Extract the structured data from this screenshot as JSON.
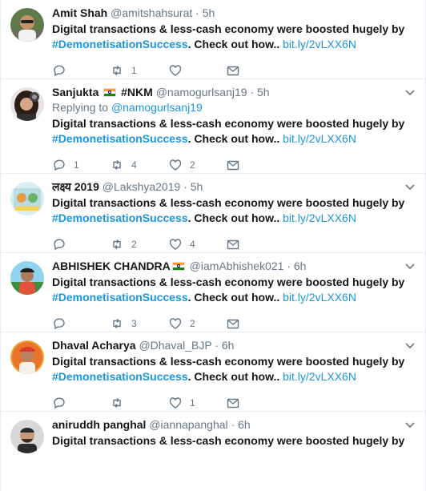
{
  "colors": {
    "accent": "#1b95e0",
    "muted": "#657786",
    "text": "#14171a",
    "border": "#e6ecf0"
  },
  "tweets": [
    {
      "name": "Amit Shah",
      "handle": "@amitshahsurat",
      "time": "5h",
      "avatar_icon": "amit-avatar",
      "text_plain": "Digital transactions & less-cash economy were boosted hugely by",
      "hashtag": "#DemonetisationSuccess",
      "text_tail": ". Check out how..",
      "link": "bit.ly/2vLXX6N",
      "replies": "",
      "retweets": "1",
      "likes": ""
    },
    {
      "name": "Sanjukta",
      "name_suffix": "#NKM",
      "handle": "@namogurlsanj19",
      "time": "5h",
      "replying_label": "Replying to",
      "replying_handle": "@namogurlsanj19",
      "avatar_icon": "sanjukta-avatar",
      "text_plain": "Digital transactions & less-cash economy were boosted hugely by",
      "hashtag": "#DemonetisationSuccess",
      "text_tail": ". Check out how..",
      "link": "bit.ly/2vLXX6N",
      "replies": "1",
      "retweets": "4",
      "likes": "2"
    },
    {
      "name": "लक्ष्य 2019",
      "handle": "@Lakshya2019",
      "time": "5h",
      "avatar_icon": "lakshya-avatar",
      "text_plain": "Digital transactions & less-cash economy were boosted hugely by",
      "hashtag": "#DemonetisationSuccess",
      "text_tail": ". Check out how..",
      "link": "bit.ly/2vLXX6N",
      "replies": "",
      "retweets": "2",
      "likes": "4"
    },
    {
      "name": "ABHISHEK CHANDRA",
      "handle": "@iamAbhishek021",
      "time": "6h",
      "avatar_icon": "abhishek-avatar",
      "text_plain": "Digital transactions & less-cash economy were boosted hugely by",
      "hashtag": "#DemonetisationSuccess",
      "text_tail": ". Check out how..",
      "link": "bit.ly/2vLXX6N",
      "replies": "",
      "retweets": "3",
      "likes": "2"
    },
    {
      "name": "Dhaval Acharya",
      "handle": "@Dhaval_BJP",
      "time": "6h",
      "avatar_icon": "dhaval-avatar",
      "text_plain": "Digital transactions & less-cash economy were boosted hugely by",
      "hashtag": "#DemonetisationSuccess",
      "text_tail": ". Check out how..",
      "link": "bit.ly/2vLXX6N",
      "replies": "",
      "retweets": "",
      "likes": "1"
    },
    {
      "name": "aniruddh panghal",
      "handle": "@iannapanghal",
      "time": "6h",
      "avatar_icon": "aniruddh-avatar",
      "text_plain": "Digital transactions & less-cash economy were boosted hugely by",
      "hashtag": "",
      "text_tail": "",
      "link": "",
      "replies": "",
      "retweets": "",
      "likes": ""
    }
  ]
}
